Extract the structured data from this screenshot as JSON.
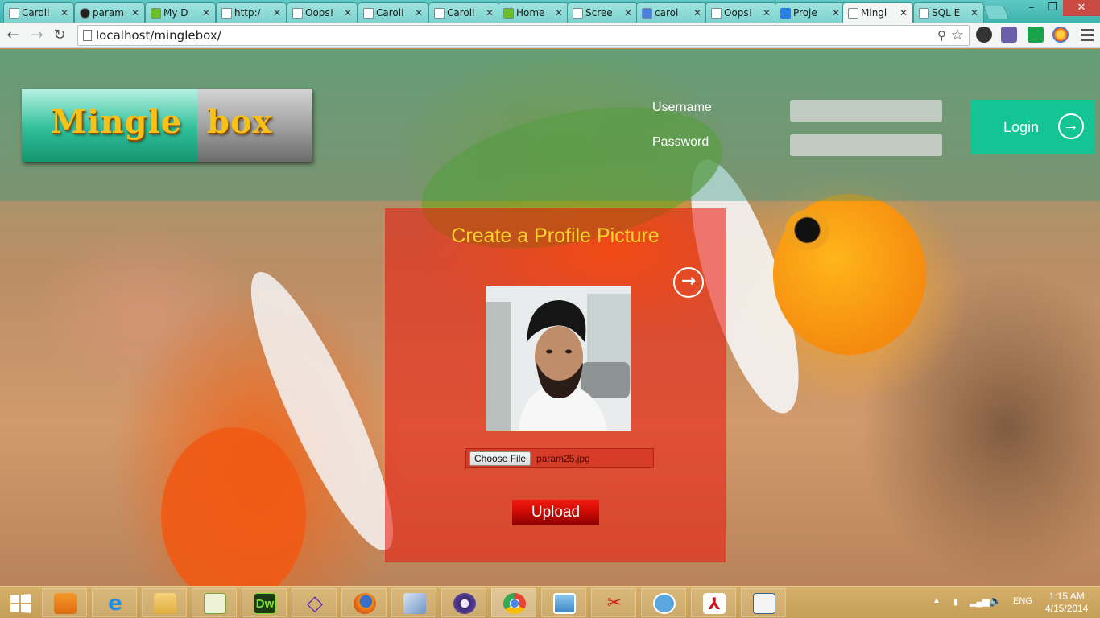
{
  "browser": {
    "tabs": [
      {
        "label": "Caroli",
        "icon": "page-icon"
      },
      {
        "label": "param",
        "icon": "github-icon"
      },
      {
        "label": "My D",
        "icon": "chart-icon"
      },
      {
        "label": "http:/",
        "icon": "page-icon"
      },
      {
        "label": "Oops!",
        "icon": "page-icon"
      },
      {
        "label": "Caroli",
        "icon": "page-icon"
      },
      {
        "label": "Caroli",
        "icon": "page-icon"
      },
      {
        "label": "Home",
        "icon": "chart-icon"
      },
      {
        "label": "Scree",
        "icon": "page-icon"
      },
      {
        "label": "carol",
        "icon": "google-icon"
      },
      {
        "label": "Oops!",
        "icon": "page-icon"
      },
      {
        "label": "Proje",
        "icon": "dropbox-icon"
      },
      {
        "label": "Mingl",
        "icon": "page-icon",
        "active": true
      },
      {
        "label": "SQL E",
        "icon": "page-icon"
      }
    ],
    "url": "localhost/minglebox/",
    "extensions": [
      "php-icon",
      "green-extension-icon",
      "gray-extension-icon",
      "color-extension-icon"
    ]
  },
  "site": {
    "logo_left": "Mingle",
    "logo_right": "box",
    "username_label": "Username",
    "password_label": "Password",
    "username_value": "",
    "password_value": "",
    "login_label": "Login"
  },
  "profile": {
    "title": "Create a Profile Picture",
    "choose_file_label": "Choose File",
    "file_name": "param25.jpg",
    "upload_label": "Upload"
  },
  "taskbar": {
    "apps": [
      "media-player-icon",
      "internet-explorer-icon",
      "file-explorer-icon",
      "notepad-plus-icon",
      "dreamweaver-icon",
      "visual-studio-icon",
      "firefox-icon",
      "virtualbox-icon",
      "eclipse-icon",
      "chrome-icon",
      "photos-icon",
      "snipping-tool-icon",
      "putty-icon",
      "adobe-reader-icon",
      "document-icon"
    ],
    "dreamweaver_text": "Dw",
    "language": "ENG",
    "time": "1:15 AM",
    "date": "4/15/2014"
  },
  "colors": {
    "accent_teal": "#13c495",
    "title_yellow": "#ffd22e",
    "upload_red": "#d00c05"
  }
}
